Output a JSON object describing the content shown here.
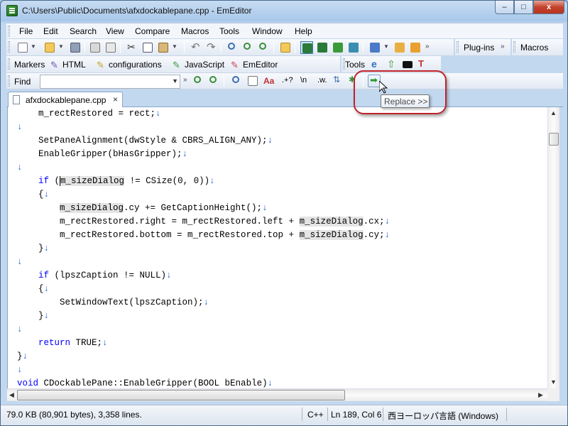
{
  "window": {
    "title": "C:\\Users\\Public\\Documents\\afxdockablepane.cpp - EmEditor",
    "minimize_label": "–",
    "maximize_label": "□",
    "close_label": "x"
  },
  "menubar": {
    "items": [
      "File",
      "Edit",
      "Search",
      "View",
      "Compare",
      "Macros",
      "Tools",
      "Window",
      "Help"
    ]
  },
  "toolbars": {
    "plugins_label": "Plug-ins",
    "macros_label": "Macros",
    "tools_label": "Tools",
    "chevron": "»",
    "markers": {
      "label": "Markers",
      "items": [
        "HTML",
        "configurations",
        "JavaScript",
        "EmEditor"
      ]
    },
    "find": {
      "label": "Find",
      "value": "",
      "placeholder": "",
      "dropdown_arrow": "▼",
      "case_label": "Aa",
      "regex_label": ".+?",
      "escape_label": "\\n",
      "word_label": ".w."
    }
  },
  "tooltip": {
    "text": "Replace >>"
  },
  "tabs": [
    {
      "label": "afxdockablepane.cpp",
      "close": "×"
    }
  ],
  "editor": {
    "eol_mark": "↓",
    "lines": [
      "    m_rectRestored = rect;",
      "",
      "    SetPaneAlignment(dwStyle & CBRS_ALIGN_ANY);",
      "    EnableGripper(bHasGripper);",
      "",
      "    if (m_sizeDialog != CSize(0, 0))",
      "    {",
      "        m_sizeDialog.cy += GetCaptionHeight();",
      "        m_rectRestored.right = m_rectRestored.left + m_sizeDialog.cx;",
      "        m_rectRestored.bottom = m_rectRestored.top + m_sizeDialog.cy;",
      "    }",
      "",
      "    if (lpszCaption != NULL)",
      "    {",
      "        SetWindowText(lpszCaption);",
      "    }",
      "",
      "    return TRUE;",
      "}",
      "",
      "void CDockablePane::EnableGripper(BOOL bEnable)"
    ]
  },
  "statusbar": {
    "size": "79.0 KB (80,901 bytes), 3,358 lines.",
    "language": "C++",
    "position": "Ln 189, Col 6",
    "encoding": "西ヨーロッパ言語 (Windows)"
  },
  "colors": {
    "keyword": "#0000ff",
    "eol_mark": "#1f5fd0",
    "highlight": "#e4e4e4",
    "annotation_ring": "#c0232b"
  }
}
